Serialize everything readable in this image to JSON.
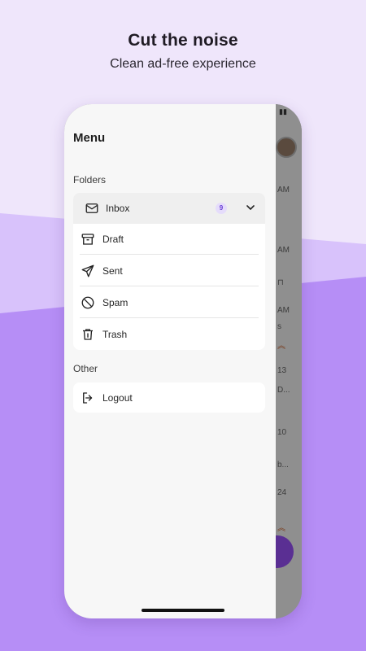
{
  "promo": {
    "title": "Cut the noise",
    "subtitle": "Clean ad-free experience"
  },
  "drawer": {
    "title": "Menu",
    "folders_label": "Folders",
    "inbox": {
      "label": "Inbox",
      "count": "9",
      "icon": "mail-icon"
    },
    "items": [
      {
        "label": "Draft",
        "icon": "archive-box-icon"
      },
      {
        "label": "Sent",
        "icon": "send-icon"
      },
      {
        "label": "Spam",
        "icon": "block-icon"
      },
      {
        "label": "Trash",
        "icon": "trash-icon"
      }
    ],
    "other_label": "Other",
    "logout": {
      "label": "Logout",
      "icon": "logout-icon"
    }
  },
  "background_app": {
    "fragments": [
      "AM",
      "AM",
      "AM",
      "s",
      "13",
      "D...",
      "10",
      "b...",
      "24"
    ]
  },
  "colors": {
    "accent": "#6a3fd6",
    "badge_bg": "#e5dcfb",
    "purple_band": "#b58cf6",
    "page_bg": "#efe6fb"
  }
}
